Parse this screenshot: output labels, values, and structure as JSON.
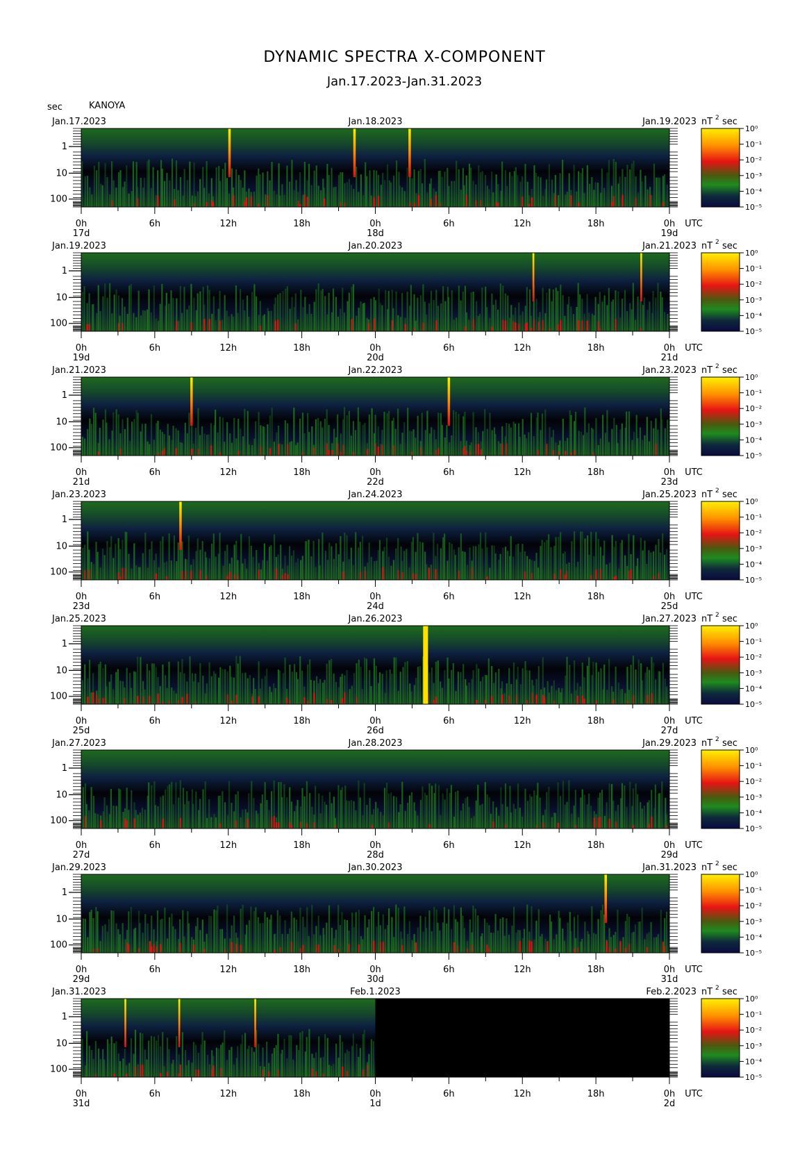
{
  "title": "DYNAMIC SPECTRA X-COMPONENT",
  "subtitle": "Jan.17.2023-Jan.31.2023",
  "station": "KANOYA",
  "unit_left": "sec",
  "unit_right": "nT",
  "unit_right_exp": "2",
  "unit_right_sec": "sec",
  "utc_label": "UTC",
  "colors": {
    "background": "#000000",
    "low": "#0a1540",
    "mid": "#1f7a1f",
    "high": "#e81010",
    "peak": "#ffe000"
  },
  "chart_data": {
    "type": "heatmap",
    "y_axis": {
      "label": "sec",
      "ticks": [
        "1",
        "10",
        "100"
      ],
      "scale": "log"
    },
    "x_axis": {
      "ticks": [
        "0h",
        "6h",
        "12h",
        "18h",
        "0h",
        "6h",
        "12h",
        "18h",
        "0h"
      ],
      "unit": "UTC"
    },
    "colorbar": {
      "label": "nT² sec",
      "ticks": [
        "10⁰",
        "10⁻¹",
        "10⁻²",
        "10⁻³",
        "10⁻⁴",
        "10⁻⁵"
      ]
    },
    "panels": [
      {
        "date_left": "Jan.17.2023",
        "date_mid": "Jan.18.2023",
        "date_right": "Jan.19.2023",
        "day_start": "17d",
        "day_mid": "18d",
        "day_end": "19d",
        "spikes_hours": [
          12.1,
          22.3,
          26.8
        ],
        "spike_width_hours": 0.2,
        "data_end_hours": 48
      },
      {
        "date_left": "Jan.19.2023",
        "date_mid": "Jan.20.2023",
        "date_right": "Jan.21.2023",
        "day_start": "19d",
        "day_mid": "20d",
        "day_end": "21d",
        "spikes_hours": [
          36.9,
          45.7
        ],
        "spike_width_hours": 0.15,
        "data_end_hours": 48
      },
      {
        "date_left": "Jan.21.2023",
        "date_mid": "Jan.22.2023",
        "date_right": "Jan.23.2023",
        "day_start": "21d",
        "day_mid": "22d",
        "day_end": "23d",
        "spikes_hours": [
          9.0,
          30.0
        ],
        "spike_width_hours": 0.2,
        "data_end_hours": 48
      },
      {
        "date_left": "Jan.23.2023",
        "date_mid": "Jan.24.2023",
        "date_right": "Jan.25.2023",
        "day_start": "23d",
        "day_mid": "24d",
        "day_end": "25d",
        "spikes_hours": [
          8.1
        ],
        "spike_width_hours": 0.2,
        "data_end_hours": 48
      },
      {
        "date_left": "Jan.25.2023",
        "date_mid": "Jan.26.2023",
        "date_right": "Jan.27.2023",
        "day_start": "25d",
        "day_mid": "26d",
        "day_end": "27d",
        "spikes_hours": [
          28.1
        ],
        "spike_width_hours": 0.4,
        "data_end_hours": 48
      },
      {
        "date_left": "Jan.27.2023",
        "date_mid": "Jan.28.2023",
        "date_right": "Jan.29.2023",
        "day_start": "27d",
        "day_mid": "28d",
        "day_end": "29d",
        "spikes_hours": [],
        "spike_width_hours": 0.2,
        "data_end_hours": 48
      },
      {
        "date_left": "Jan.29.2023",
        "date_mid": "Jan.30.2023",
        "date_right": "Jan.31.2023",
        "day_start": "29d",
        "day_mid": "30d",
        "day_end": "31d",
        "spikes_hours": [
          42.8
        ],
        "spike_width_hours": 0.2,
        "data_end_hours": 48
      },
      {
        "date_left": "Jan.31.2023",
        "date_mid": "Feb.1.2023",
        "date_right": "Feb.2.2023",
        "day_start": "31d",
        "day_mid": "1d",
        "day_end": "2d",
        "spikes_hours": [
          3.6,
          8.0,
          14.2
        ],
        "spike_width_hours": 0.15,
        "data_end_hours": 24
      }
    ]
  }
}
